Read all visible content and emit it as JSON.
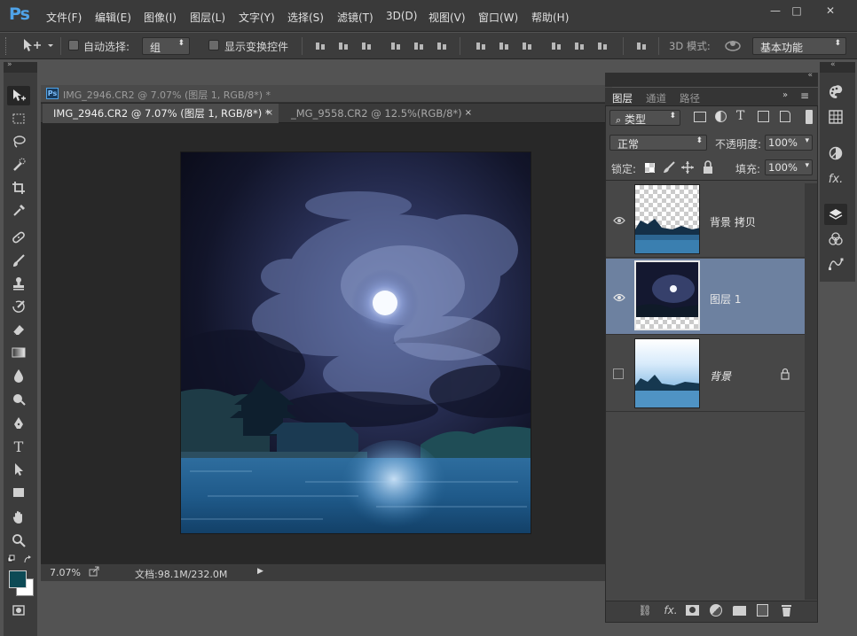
{
  "app": {
    "logo": "Ps"
  },
  "menu": [
    "文件(F)",
    "编辑(E)",
    "图像(I)",
    "图层(L)",
    "文字(Y)",
    "选择(S)",
    "滤镜(T)",
    "3D(D)",
    "视图(V)",
    "窗口(W)",
    "帮助(H)"
  ],
  "window_controls": {
    "minimize": "—",
    "maximize": "□",
    "close": "✕"
  },
  "options": {
    "auto_select_label": "自动选择:",
    "auto_select_value": "组",
    "show_transform_label": "显示变换控件",
    "mode_3d_label": "3D 模式:",
    "workspace_value": "基本功能"
  },
  "document": {
    "window_title": "IMG_2946.CR2 @ 7.07% (图层 1, RGB/8*) *",
    "tabs": [
      {
        "label": "IMG_2946.CR2 @ 7.07% (图层 1, RGB/8*) *",
        "close": "×"
      },
      {
        "label": "_MG_9558.CR2 @ 12.5%(RGB/8*)",
        "close": "×"
      }
    ],
    "zoom": "7.07%",
    "doc_size": "文档:98.1M/232.0M"
  },
  "layers_panel": {
    "tabs": [
      "图层",
      "通道",
      "路径"
    ],
    "filter_kind": "类型",
    "blend_mode": "正常",
    "opacity_label": "不透明度:",
    "opacity_value": "100%",
    "lock_label": "锁定:",
    "fill_label": "填充:",
    "fill_value": "100%",
    "layers": [
      {
        "name": "背景 拷贝",
        "visible": true,
        "selected": false,
        "locked": false
      },
      {
        "name": "图层 1",
        "visible": true,
        "selected": true,
        "locked": false
      },
      {
        "name": "背景",
        "visible": false,
        "selected": false,
        "locked": true
      }
    ],
    "bottom_icons": [
      "link-icon",
      "fx-icon",
      "mask-icon",
      "adjustment-icon",
      "folder-icon",
      "new-layer-icon",
      "trash-icon"
    ],
    "fx_label": "fx."
  },
  "colors": {
    "foreground": "#0d4a55",
    "background": "#ffffff",
    "selection": "#6d81a0",
    "logo": "#4fa3e8"
  }
}
